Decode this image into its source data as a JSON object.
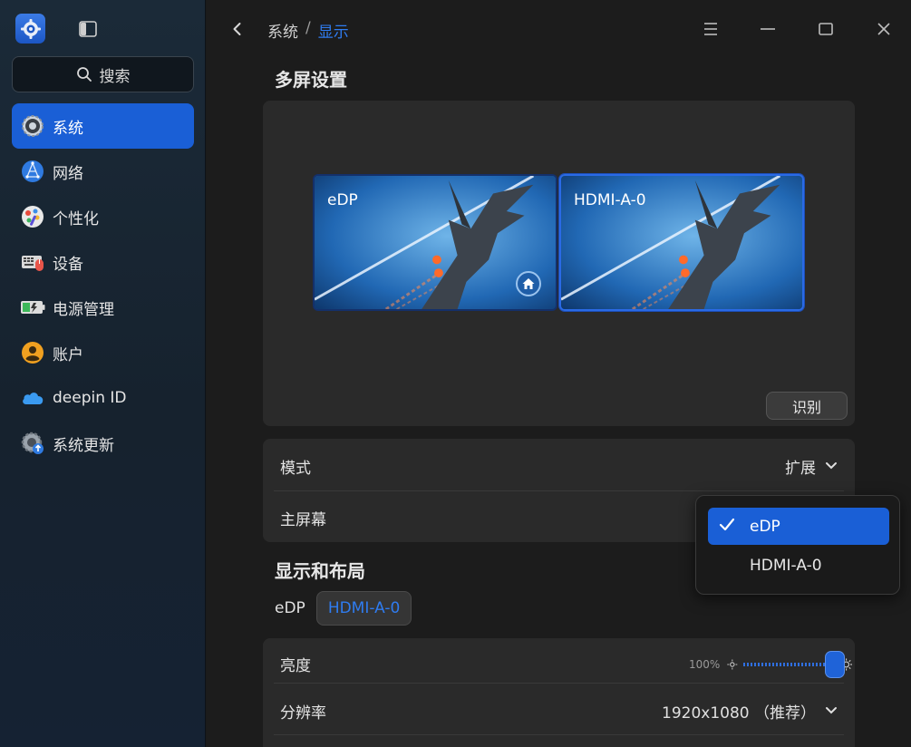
{
  "app": {
    "icon": "settings-gear-icon"
  },
  "sidebar": {
    "search_label": "搜索",
    "items": [
      {
        "label": "系统",
        "icon": "system-gear-icon",
        "active": true
      },
      {
        "label": "网络",
        "icon": "network-icon",
        "active": false
      },
      {
        "label": "个性化",
        "icon": "personalization-icon",
        "active": false
      },
      {
        "label": "设备",
        "icon": "devices-icon",
        "active": false
      },
      {
        "label": "电源管理",
        "icon": "power-icon",
        "active": false
      },
      {
        "label": "账户",
        "icon": "account-icon",
        "active": false
      },
      {
        "label": "deepin ID",
        "icon": "cloud-icon",
        "active": false
      },
      {
        "label": "系统更新",
        "icon": "update-icon",
        "active": false
      }
    ]
  },
  "header": {
    "breadcrumb_parent": "系统",
    "breadcrumb_sep": "/",
    "breadcrumb_current": "显示"
  },
  "multi_screen": {
    "title": "多屏设置",
    "monitors": [
      {
        "label": "eDP",
        "primary": true
      },
      {
        "label": "HDMI-A-0",
        "primary": false,
        "selected": true
      }
    ],
    "identify_label": "识别"
  },
  "mode_card": {
    "mode_label": "模式",
    "mode_value": "扩展",
    "primary_label": "主屏幕"
  },
  "layout": {
    "title": "显示和布局",
    "tabs": [
      "eDP",
      "HDMI-A-0"
    ],
    "active_tab": "HDMI-A-0"
  },
  "display_card": {
    "brightness_label": "亮度",
    "brightness_value": "100%",
    "brightness_level": 1.0,
    "resolution_label": "分辨率",
    "resolution_value": "1920x1080 （推荐）"
  },
  "primary_dropdown": {
    "options": [
      "eDP",
      "HDMI-A-0"
    ],
    "selected": "eDP"
  },
  "colors": {
    "accent": "#1a5fd6",
    "link": "#2f7cf0"
  }
}
